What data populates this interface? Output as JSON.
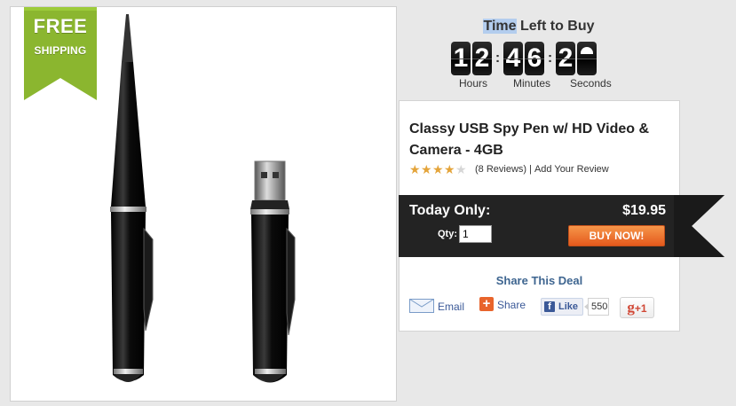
{
  "badge": {
    "line1": "FREE",
    "line2": "SHIPPING",
    "color": "#8bb62f"
  },
  "timer": {
    "title_highlight": "Time",
    "title_rest": " Left to Buy",
    "hours": [
      "1",
      "2"
    ],
    "minutes": [
      "4",
      "6"
    ],
    "seconds": [
      "2",
      ""
    ],
    "separator": ":",
    "label_hours": "Hours",
    "label_minutes": "Minutes",
    "label_seconds": "Seconds"
  },
  "product": {
    "title_line1": "Classy USB Spy Pen w/ HD Video &",
    "title_line2": "Camera - 4GB",
    "rating": 4,
    "rating_max": 5,
    "reviews_text": "(8 Reviews)",
    "divider": "|",
    "add_review": "Add Your Review"
  },
  "offer": {
    "label": "Today Only:",
    "price": "$19.95",
    "qty_label": "Qty:",
    "qty_value": "1",
    "buy_label": "BUY NOW!",
    "banner_color": "#232323",
    "button_color": "#e8642c"
  },
  "share": {
    "title": "Share This Deal",
    "email_label": "Email",
    "share_label": "Share",
    "share_icon": "+",
    "like_icon": "f",
    "like_label": "Like",
    "like_count": "550",
    "gplus_g": "g",
    "gplus_plus": "+1"
  }
}
